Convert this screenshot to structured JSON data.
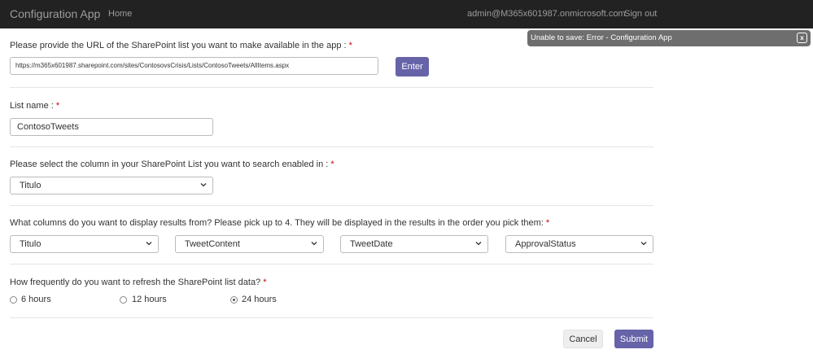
{
  "navbar": {
    "brand": "Configuration App",
    "home": "Home",
    "user": "admin@M365x601987.onmicrosoft.com",
    "signout": "Sign out"
  },
  "toast": {
    "message": "Unable to save: Error - Configuration App",
    "close": "x"
  },
  "form": {
    "url": {
      "label": "Please provide the URL of the SharePoint list you want to make available in the app : ",
      "value": "https://m365x601987.sharepoint.com/sites/ContosovsCrisis/Lists/ContosoTweets/AllItems.aspx",
      "enter_label": "Enter"
    },
    "list_name": {
      "label": "List name : ",
      "value": "ContosoTweets"
    },
    "search_column": {
      "label": "Please select the column in your SharePoint List you want to search enabled in : ",
      "selected": "Titulo"
    },
    "display_columns": {
      "label": "What columns do you want to display results from? Please pick up to 4. They will be displayed in the results in the order you pick them: ",
      "selected": [
        "Titulo",
        "TweetContent",
        "TweetDate",
        "ApprovalStatus"
      ]
    },
    "refresh": {
      "label": "How frequently do you want to refresh the SharePoint list data? ",
      "options": [
        "6 hours",
        "12 hours",
        "24 hours"
      ],
      "selected": "24 hours"
    },
    "required_marker": "*",
    "cancel_label": "Cancel",
    "submit_label": "Submit"
  },
  "colors": {
    "navbar_bg": "#222222",
    "primary": "#6663a9",
    "required": "#cc0000",
    "toast_bg": "#6e6e6e"
  },
  "icons": {
    "select": "chevron-down-icon",
    "toast_close": "close-icon"
  }
}
